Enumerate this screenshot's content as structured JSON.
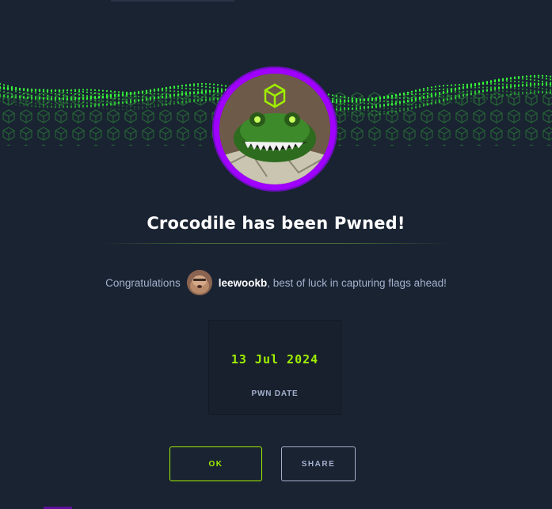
{
  "machine": {
    "title": "Crocodile has been Pwned!",
    "logo_icon": "crocodile-machine-avatar",
    "ring_color": "#9f00ff"
  },
  "congrats": {
    "prefix": "Congratulations",
    "username": "leewookb",
    "suffix": ", best of luck in capturing flags ahead!",
    "avatar_icon": "user-avatar"
  },
  "pwn": {
    "date": "13 Jul 2024",
    "label": "PWN DATE"
  },
  "buttons": {
    "ok": "OK",
    "share": "SHARE"
  },
  "colors": {
    "background": "#1a2332",
    "accent_green": "#9fef00",
    "text_muted": "#a4b1cd",
    "purple": "#9f00ff"
  }
}
